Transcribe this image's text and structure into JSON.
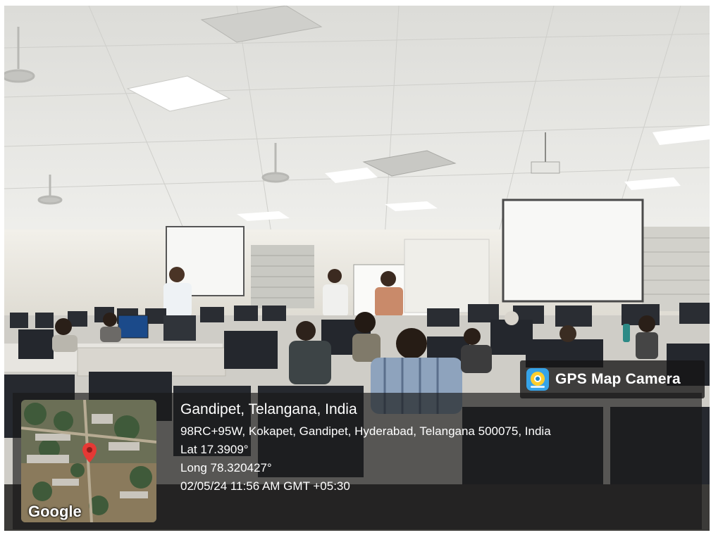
{
  "overlay": {
    "app_title": "GPS Map Camera",
    "app_icon": "gps-map-camera-icon",
    "map_logo": "Google",
    "map_pin_color": "#e53935",
    "location_title": "Gandipet, Telangana, India",
    "address": "98RC+95W, Kokapet, Gandipet, Hyderabad, Telangana 500075, India",
    "lat": "Lat 17.3909°",
    "long": "Long 78.320427°",
    "datetime": "02/05/24 11:56 AM GMT +05:30"
  }
}
